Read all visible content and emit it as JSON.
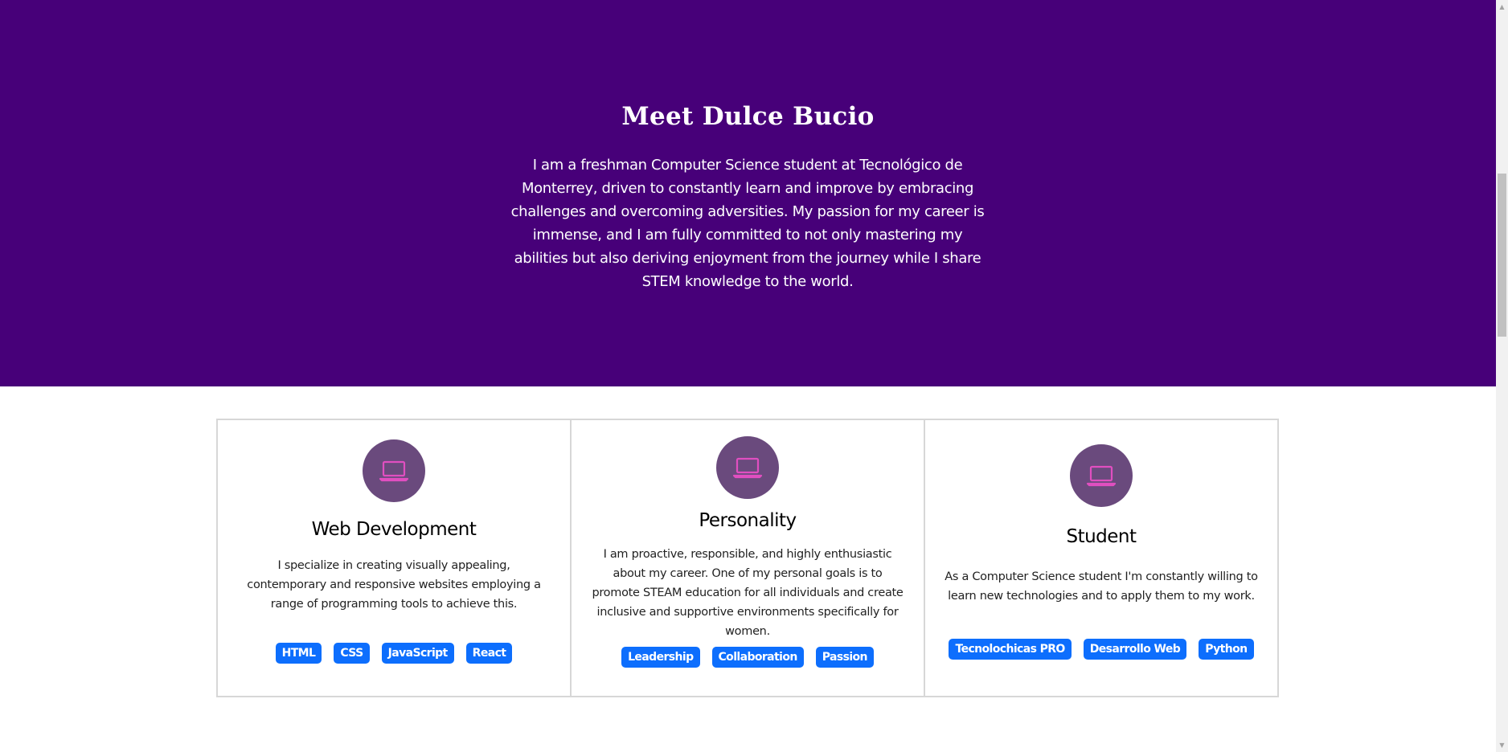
{
  "hero": {
    "title": "Meet Dulce Bucio",
    "text": "I am a freshman Computer Science student at Tecnológico de Monterrey, driven to constantly learn and improve by embracing challenges and overcoming adversities. My passion for my career is immense, and I am fully committed to not only mastering my abilities but also deriving enjoyment from the journey while I share STEM knowledge to the world.",
    "background_color": "#470079"
  },
  "cards": [
    {
      "icon": "laptop-icon",
      "title": "Web Development",
      "text": "I specialize in creating visually appealing, contemporary and responsive websites employing a range of programming tools to achieve this.",
      "tags": [
        "HTML",
        "CSS",
        "JavaScript",
        "React"
      ]
    },
    {
      "icon": "laptop-icon",
      "title": "Personality",
      "text": "I am proactive, responsible, and highly enthusiastic about my career. One of my personal goals is to promote STEAM education for all individuals and create inclusive and supportive environments specifically for women.",
      "tags": [
        "Leadership",
        "Collaboration",
        "Passion"
      ]
    },
    {
      "icon": "laptop-icon",
      "title": "Student",
      "text": "As a Computer Science student I'm constantly willing to learn new technologies and to apply them to my work.",
      "tags": [
        "Tecnolochicas PRO",
        "Desarrollo Web",
        "Python"
      ]
    }
  ],
  "colors": {
    "icon_circle": "#6a4a7d",
    "icon_stroke": "#e04fc0",
    "tag_background": "#0d6efd"
  },
  "scrollbar": {
    "up_arrow_icon": "triangle-up-icon",
    "down_arrow_icon": "triangle-down-icon"
  }
}
